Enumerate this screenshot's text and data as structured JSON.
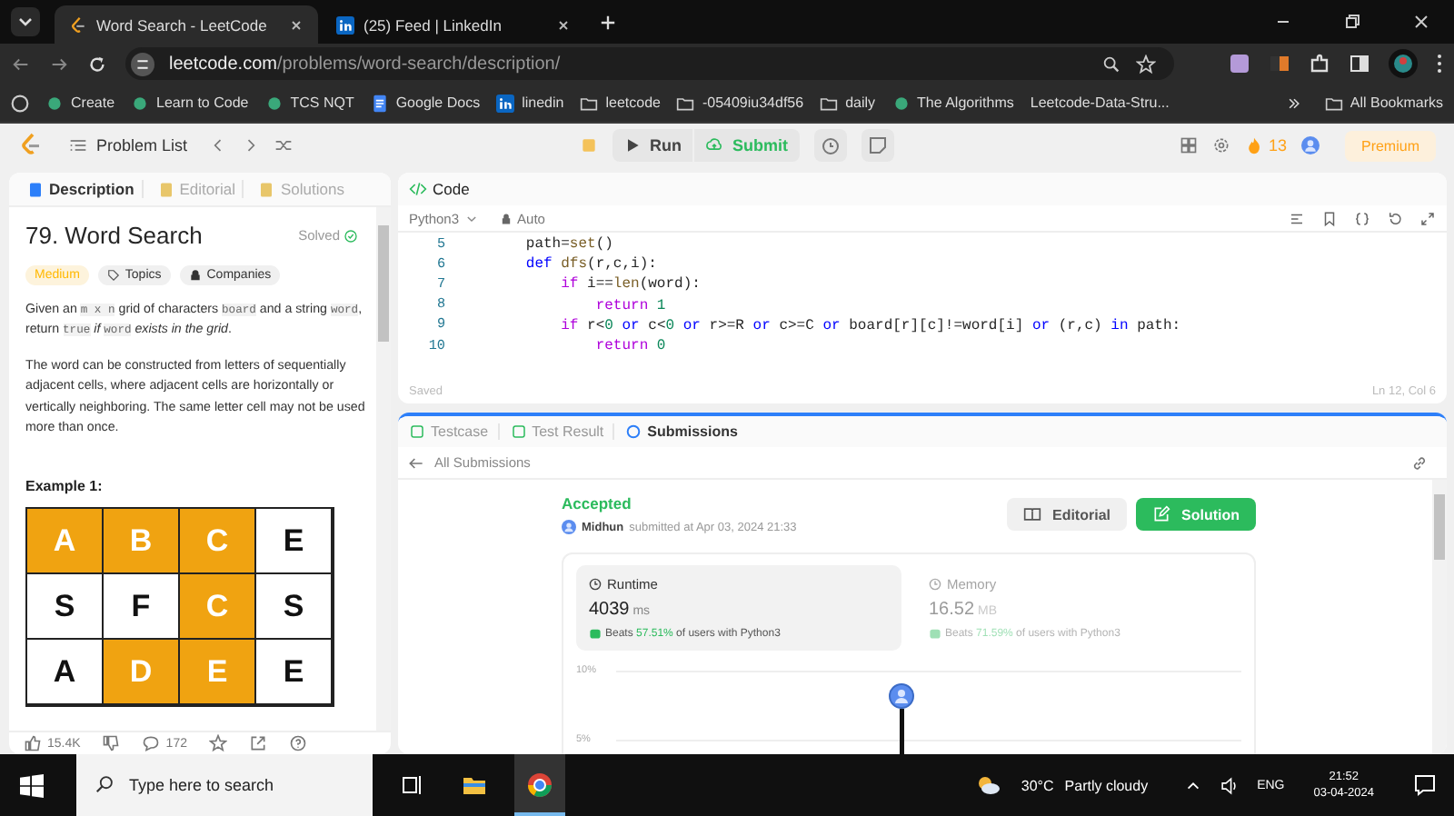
{
  "browser": {
    "tabs": [
      {
        "title": "Word Search - LeetCode",
        "selected": true
      },
      {
        "title": "(25) Feed | LinkedIn",
        "selected": false
      }
    ],
    "address": {
      "domain": "leetcode.com",
      "path": "/problems/word-search/description/"
    },
    "bookmarks": [
      {
        "label": "Create",
        "kind": "link"
      },
      {
        "label": "Learn to Code",
        "kind": "link"
      },
      {
        "label": "TCS NQT",
        "kind": "link"
      },
      {
        "label": "Google Docs",
        "kind": "doc"
      },
      {
        "label": "linedin",
        "kind": "linkedin"
      },
      {
        "label": "leetcode",
        "kind": "folder"
      },
      {
        "label": "-05409iu34df56",
        "kind": "folder"
      },
      {
        "label": "daily",
        "kind": "folder"
      },
      {
        "label": "The Algorithms",
        "kind": "link"
      },
      {
        "label": "Leetcode-Data-Stru...",
        "kind": "plain"
      }
    ],
    "all_bookmarks": "All Bookmarks"
  },
  "nav": {
    "problem_list": "Problem List",
    "run": "Run",
    "submit": "Submit",
    "streak": "13",
    "premium": "Premium"
  },
  "problem": {
    "tabs": [
      {
        "label": "Description",
        "selected": true
      },
      {
        "label": "Editorial",
        "selected": false
      },
      {
        "label": "Solutions",
        "selected": false
      }
    ],
    "title": "79. Word Search",
    "status": "Solved",
    "difficulty": "Medium",
    "tags": [
      "Topics",
      "Companies"
    ],
    "paragraphs": [
      [
        {
          "text": "Given an ",
          "kind": "text"
        },
        {
          "text": "m x n",
          "kind": "code"
        },
        {
          "text": " grid of characters ",
          "kind": "text"
        },
        {
          "text": "board",
          "kind": "code"
        },
        {
          "text": " and a string ",
          "kind": "text"
        },
        {
          "text": "word",
          "kind": "code"
        },
        {
          "text": ", return ",
          "kind": "text"
        },
        {
          "text": "true",
          "kind": "code"
        },
        {
          "text": " if ",
          "kind": "italic"
        },
        {
          "text": "word",
          "kind": "code"
        },
        {
          "text": " exists in the grid",
          "kind": "italic"
        },
        {
          "text": ".",
          "kind": "text"
        }
      ],
      [
        {
          "text": "The word can be constructed from letters of sequentially adjacent cells, where adjacent cells are horizontally or vertically neighboring. The same letter cell may not be used more than once.",
          "kind": "text"
        }
      ]
    ],
    "example_title": "Example 1:",
    "board": [
      [
        {
          "letter": "A",
          "highlighted": true
        },
        {
          "letter": "B",
          "highlighted": true
        },
        {
          "letter": "C",
          "highlighted": true
        },
        {
          "letter": "E",
          "highlighted": false
        }
      ],
      [
        {
          "letter": "S",
          "highlighted": false
        },
        {
          "letter": "F",
          "highlighted": false
        },
        {
          "letter": "C",
          "highlighted": true
        },
        {
          "letter": "S",
          "highlighted": false
        }
      ],
      [
        {
          "letter": "A",
          "highlighted": false
        },
        {
          "letter": "D",
          "highlighted": true
        },
        {
          "letter": "E",
          "highlighted": true
        },
        {
          "letter": "E",
          "highlighted": false
        }
      ]
    ],
    "likes": "15.4K",
    "comments": "172"
  },
  "code": {
    "title": "Code",
    "language": "Python3",
    "mode": "Auto",
    "lines": [
      {
        "number": "5",
        "tokens": [
          {
            "t": "        path=",
            "kind": "plain"
          },
          {
            "t": "set",
            "kind": "function"
          },
          {
            "t": "()",
            "kind": "plain"
          }
        ]
      },
      {
        "number": "6",
        "tokens": [
          {
            "t": "        def",
            "kind": "keyword"
          },
          {
            "t": " dfs",
            "kind": "function"
          },
          {
            "t": "(r,c,i):",
            "kind": "plain"
          }
        ]
      },
      {
        "number": "7",
        "tokens": [
          {
            "t": "            if",
            "kind": "control"
          },
          {
            "t": " i==",
            "kind": "plain"
          },
          {
            "t": "len",
            "kind": "function"
          },
          {
            "t": "(word):",
            "kind": "plain"
          }
        ]
      },
      {
        "number": "8",
        "tokens": [
          {
            "t": "                return",
            "kind": "control"
          },
          {
            "t": " 1",
            "kind": "number"
          }
        ]
      },
      {
        "number": "9",
        "tokens": [
          {
            "t": "            if",
            "kind": "control"
          },
          {
            "t": " r<",
            "kind": "plain"
          },
          {
            "t": "0",
            "kind": "number"
          },
          {
            "t": " or",
            "kind": "keyword"
          },
          {
            "t": " c<",
            "kind": "plain"
          },
          {
            "t": "0",
            "kind": "number"
          },
          {
            "t": " or",
            "kind": "keyword"
          },
          {
            "t": " r>=R ",
            "kind": "plain"
          },
          {
            "t": "or",
            "kind": "keyword"
          },
          {
            "t": " c>=C ",
            "kind": "plain"
          },
          {
            "t": "or",
            "kind": "keyword"
          },
          {
            "t": " board[r][c]!=word[i] ",
            "kind": "plain"
          },
          {
            "t": "or",
            "kind": "keyword"
          },
          {
            "t": " (r,c) ",
            "kind": "plain"
          },
          {
            "t": "in",
            "kind": "keyword"
          },
          {
            "t": " path:",
            "kind": "plain"
          }
        ]
      },
      {
        "number": "10",
        "tokens": [
          {
            "t": "                return",
            "kind": "control"
          },
          {
            "t": " 0",
            "kind": "number"
          }
        ]
      }
    ],
    "status": "Saved",
    "cursor": "Ln 12, Col 6"
  },
  "results": {
    "tabs": [
      {
        "label": "Testcase",
        "selected": false
      },
      {
        "label": "Test Result",
        "selected": false
      },
      {
        "label": "Submissions",
        "selected": true
      }
    ],
    "back": "All Submissions",
    "verdict": "Accepted",
    "user": "Midhun",
    "submitted": "submitted at Apr 03, 2024 21:33",
    "editorial": "Editorial",
    "solution": "Solution",
    "stats": [
      {
        "label": "Runtime",
        "value": "4039",
        "unit": "ms",
        "beats": "Beats",
        "percent": "57.51%",
        "suffix": "of users with Python3",
        "selected": true
      },
      {
        "label": "Memory",
        "value": "16.52",
        "unit": "MB",
        "beats": "Beats",
        "percent": "71.59%",
        "suffix": "of users with Python3",
        "selected": false
      }
    ],
    "axis_labels": [
      "10%",
      "5%"
    ]
  },
  "taskbar": {
    "search": {
      "placeholder": "Type here to search"
    },
    "temperature": "30°C",
    "weather": "Partly cloudy",
    "language": "ENG",
    "time": "21:52",
    "date": "03-04-2024"
  }
}
